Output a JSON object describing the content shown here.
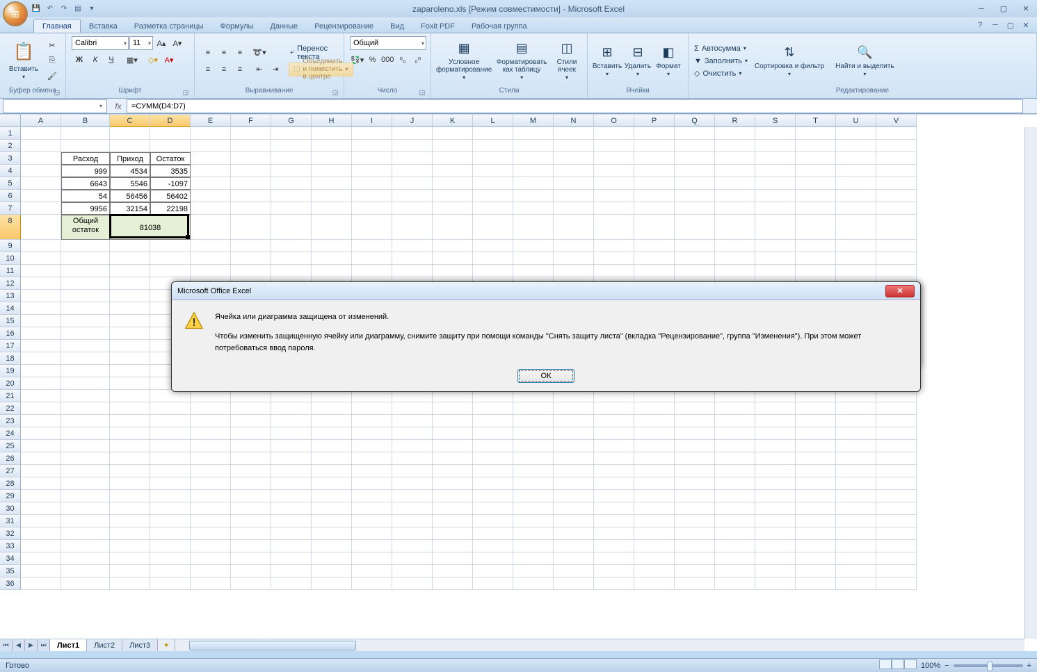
{
  "title": "zaparoleno.xls  [Режим совместимости] - Microsoft Excel",
  "tabs": [
    "Главная",
    "Вставка",
    "Разметка страницы",
    "Формулы",
    "Данные",
    "Рецензирование",
    "Вид",
    "Foxit PDF",
    "Рабочая группа"
  ],
  "active_tab": 0,
  "ribbon": {
    "clipboard": {
      "paste": "Вставить",
      "label": "Буфер обмена"
    },
    "font": {
      "name": "Calibri",
      "size": "11",
      "label": "Шрифт"
    },
    "align": {
      "wrap": "Перенос текста",
      "merge": "Объединить и поместить в центре",
      "label": "Выравнивание"
    },
    "number": {
      "format": "Общий",
      "label": "Число"
    },
    "styles": {
      "cond": "Условное форматирование",
      "table": "Форматировать как таблицу",
      "cell": "Стили ячеек",
      "label": "Стили"
    },
    "cells": {
      "insert": "Вставить",
      "delete": "Удалить",
      "format": "Формат",
      "label": "Ячейки"
    },
    "editing": {
      "sum": "Автосумма",
      "fill": "Заполнить",
      "clear": "Очистить",
      "sort": "Сортировка и фильтр",
      "find": "Найти и выделить",
      "label": "Редактирование"
    }
  },
  "namebox": "",
  "formula": "=СУММ(D4:D7)",
  "columns": [
    "A",
    "B",
    "C",
    "D",
    "E",
    "F",
    "G",
    "H",
    "I",
    "J",
    "K",
    "L",
    "M",
    "N",
    "O",
    "P",
    "Q",
    "R",
    "S",
    "T",
    "U",
    "V"
  ],
  "col_widths": {
    "default": 58,
    "B": 70,
    "C": 58,
    "D": 58
  },
  "active_merge": {
    "col_start": 2,
    "col_end": 3,
    "row": 7
  },
  "table": {
    "headers": [
      "Расход",
      "Приход",
      "Остаток"
    ],
    "rows": [
      [
        "999",
        "4534",
        "3535"
      ],
      [
        "6643",
        "5546",
        "-1097"
      ],
      [
        "54",
        "56456",
        "56402"
      ],
      [
        "9956",
        "32154",
        "22198"
      ]
    ],
    "total_label": "Общий остаток",
    "total_value": "81038"
  },
  "sheets": [
    "Лист1",
    "Лист2",
    "Лист3"
  ],
  "active_sheet": 0,
  "status": "Готово",
  "zoom": "100%",
  "dialog": {
    "title": "Microsoft Office Excel",
    "line1": "Ячейка или диаграмма защищена от изменений.",
    "line2": "Чтобы изменить защищенную ячейку или диаграмму, снимите защиту при помощи команды \"Снять защиту листа\" (вкладка \"Рецензирование\", группа \"Изменения\"). При этом может потребоваться ввод пароля.",
    "ok": "ОК"
  }
}
